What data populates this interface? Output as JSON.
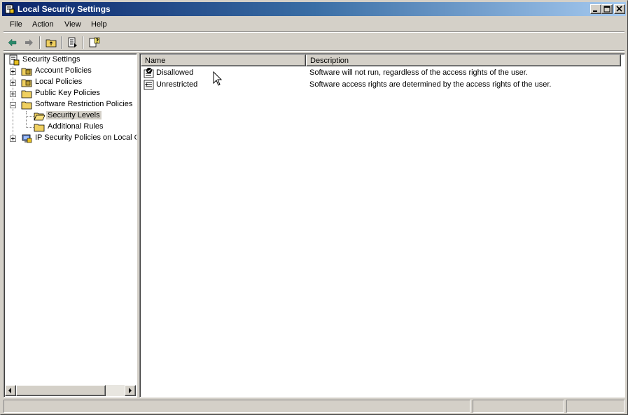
{
  "window": {
    "title": "Local Security Settings",
    "title_gradient": [
      "#0a246a",
      "#a6caf0"
    ]
  },
  "menu": {
    "items": [
      "File",
      "Action",
      "View",
      "Help"
    ]
  },
  "toolbar": {
    "buttons": [
      "back-arrow-icon",
      "forward-arrow-icon",
      "up-folder-icon",
      "export-list-icon",
      "help-icon"
    ]
  },
  "tree": {
    "root": "Security Settings",
    "items": [
      {
        "label": "Account Policies"
      },
      {
        "label": "Local Policies"
      },
      {
        "label": "Public Key Policies"
      },
      {
        "label": "Software Restriction Policies"
      },
      {
        "label": "Security Levels",
        "selected": true
      },
      {
        "label": "Additional Rules"
      },
      {
        "label": "IP Security Policies on Local Co"
      }
    ]
  },
  "list": {
    "columns": [
      "Name",
      "Description"
    ],
    "rows": [
      {
        "name": "Disallowed",
        "description": "Software will not run, regardless of the access rights of the user.",
        "icon": "disallowed-icon"
      },
      {
        "name": "Unrestricted",
        "description": "Software access rights are determined by the access rights of the user.",
        "icon": "unrestricted-icon"
      }
    ]
  },
  "status": {
    "panels": [
      "",
      "",
      ""
    ]
  }
}
